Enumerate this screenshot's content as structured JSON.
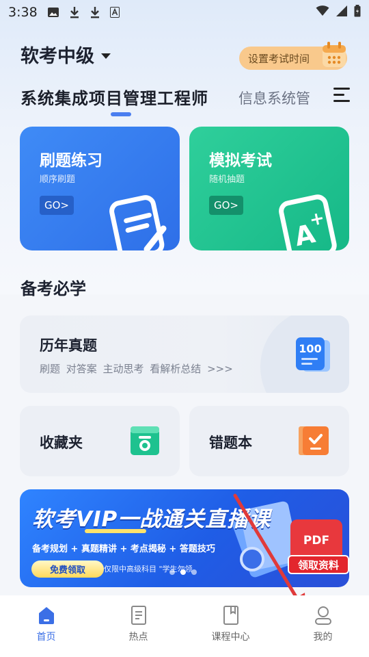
{
  "status_bar": {
    "time": "3:38"
  },
  "header": {
    "exam_level": "软考中级",
    "set_time_button": "设置考试时间"
  },
  "subject_tabs": {
    "active": "系统集成项目管理工程师",
    "other": "信息系统管"
  },
  "practice_cards": [
    {
      "title": "刷题练习",
      "subtitle": "顺序刷题",
      "go": "GO>"
    },
    {
      "title": "模拟考试",
      "subtitle": "随机抽题",
      "go": "GO>"
    }
  ],
  "section": {
    "title": "备考必学",
    "past_papers": {
      "title": "历年真题",
      "tags": "刷题  对答案  主动思考  看解析总结 >>>",
      "badge": "100"
    },
    "favorites": "收藏夹",
    "wrong_book": "错题本"
  },
  "banner": {
    "title": "软考VIP一战通关直播课",
    "subtitle": "备考规划 + 真题精讲 + 考点揭秘 + 答题技巧",
    "button": "免费领取",
    "note": "仅限中高级科目 \"学生勿领",
    "pdf": "PDF",
    "claim": "领取资料",
    "dots": 3,
    "active_dot": 2
  },
  "bottom_nav": [
    {
      "label": "首页",
      "icon": "home-icon",
      "active": true
    },
    {
      "label": "热点",
      "icon": "document-icon",
      "active": false
    },
    {
      "label": "课程中心",
      "icon": "book-icon",
      "active": false
    },
    {
      "label": "我的",
      "icon": "user-icon",
      "active": false
    }
  ],
  "colors": {
    "accent": "#3b6fe6",
    "blue_card": "#3f8bf6",
    "green_card": "#1fc28f",
    "arrow": "#e03a3a"
  }
}
